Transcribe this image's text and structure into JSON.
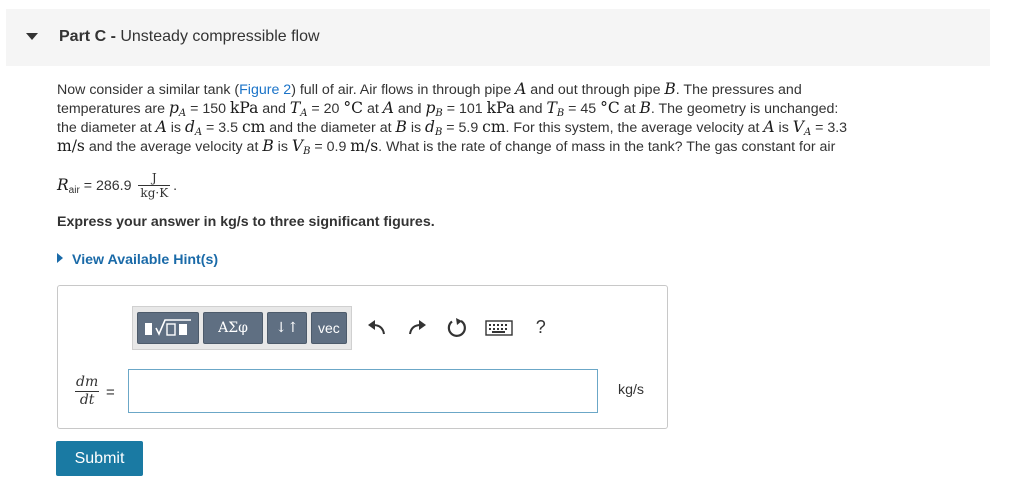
{
  "header": {
    "part_label": "Part C",
    "separator": " - ",
    "part_name": "Unsteady compressible flow"
  },
  "problem": {
    "l1_a": "Now consider a similar tank (",
    "figure_link": "Figure 2",
    "l1_b": ") full of air. Air flows in through pipe ",
    "A": "A",
    "l1_c": " and out through pipe ",
    "B": "B",
    "l1_d": ". The pressures and",
    "l2_a": "temperatures are ",
    "pA": "p",
    "pA_sub": "A",
    "l2_b": " = 150 ",
    "kPa": "kPa",
    "l2_c": " and ",
    "TA": "T",
    "TA_sub": "A",
    "l2_d": " = 20 ",
    "degC": "°C",
    "l2_e": " at ",
    "l2_f": " and ",
    "pB": "p",
    "pB_sub": "B",
    "l2_g": " = 101 ",
    "l2_h": " and ",
    "TB": "T",
    "TB_sub": "B",
    "l2_i": " = 45 ",
    "l2_j": " at ",
    "l2_k": ". The geometry is unchanged:",
    "l3_a": "the diameter at ",
    "l3_b": " is ",
    "dA": "d",
    "dA_sub": "A",
    "l3_c": " = 3.5 ",
    "cm": "cm",
    "l3_d": " and the diameter at ",
    "l3_e": " is ",
    "dB": "d",
    "dB_sub": "B",
    "l3_f": " = 5.9 ",
    "l3_g": ". For this system, the average velocity at ",
    "l3_h": " is ",
    "VA": "V",
    "VA_sub": "A",
    "l3_i": " = 3.3",
    "ms": "m/s",
    "l4_a": " and the average velocity at ",
    "l4_b": " is ",
    "VB": "V",
    "VB_sub": "B",
    "l4_c": " = 0.9 ",
    "l4_d": ". What is the rate of change of mass in the tank? The gas constant for air",
    "R": "R",
    "R_sub": "air",
    "l5_a": " = 286.9 ",
    "R_num": "J",
    "R_den": "kg·K",
    "l5_b": "."
  },
  "instruction": "Express your answer in kg/s to three significant figures.",
  "hints_label": "View Available Hint(s)",
  "toolbar": {
    "templates_icon": "templates-icon",
    "greek_label": "ΑΣφ",
    "arrows_label": "↓↑",
    "vec_label": "vec",
    "undo_icon": "undo-icon",
    "redo_icon": "redo-icon",
    "reset_icon": "reset-icon",
    "keyboard_icon": "keyboard-icon",
    "help_label": "?"
  },
  "answer": {
    "lhs_num": "dm",
    "lhs_den": "dt",
    "equals": "=",
    "value": "",
    "units": "kg/s"
  },
  "submit_label": "Submit",
  "colors": {
    "link": "#1a73c8",
    "hint": "#1a6aa8",
    "submit_bg": "#1a7aa3",
    "toolbar_btn": "#5f6f82",
    "input_border": "#6ba7c7"
  }
}
